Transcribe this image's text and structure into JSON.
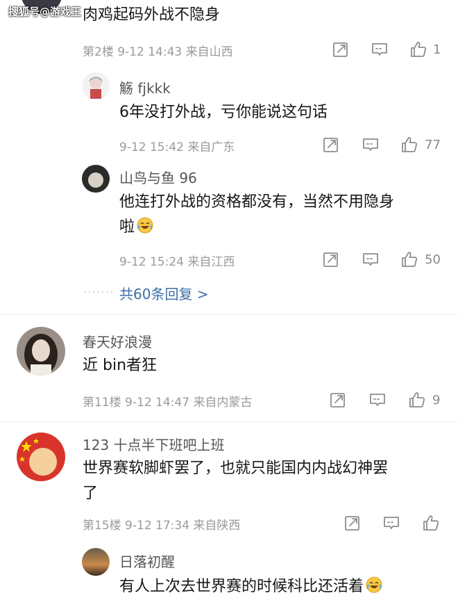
{
  "watermark": "搜狐号@游戏王",
  "comments": [
    {
      "content": "肉鸡起码外战不隐身",
      "floor": "第2楼",
      "time": "9-12 14:43",
      "location": "来自山西",
      "likes": "1",
      "replies": [
        {
          "user": "觞 fjkkk",
          "content": "6年没打外战，亏你能说这句话",
          "time": "9-12 15:42",
          "location": "来自广东",
          "likes": "77"
        },
        {
          "user": "山鸟与鱼 96",
          "content_line1": "他连打外战的资格都没有，当然不用隐身",
          "content_line2": "啦",
          "time": "9-12 15:24",
          "location": "来自江西",
          "likes": "50"
        }
      ],
      "more_replies": "共60条回复 >"
    },
    {
      "user": "春天好浪漫",
      "content": "近 bin者狂",
      "floor": "第11楼",
      "time": "9-12 14:47",
      "location": "来自内蒙古",
      "likes": "9"
    },
    {
      "user": "123 十点半下班吧上班",
      "content_line1": "世界赛软脚虾罢了，也就只能国内内战幻神罢",
      "content_line2": "了",
      "floor": "第15楼",
      "time": "9-12 17:34",
      "location": "来自陕西",
      "likes": "",
      "replies": [
        {
          "user": "日落初醒",
          "content": "有人上次去世界赛的时候科比还活着"
        }
      ]
    }
  ],
  "icons": {
    "share": "share-edit-icon",
    "comment": "comment-icon",
    "like": "thumbs-up-icon",
    "emoji": "laughing-tears-emoji"
  },
  "colors": {
    "meta": "#9a9a9a",
    "link": "#3c6ea8"
  }
}
